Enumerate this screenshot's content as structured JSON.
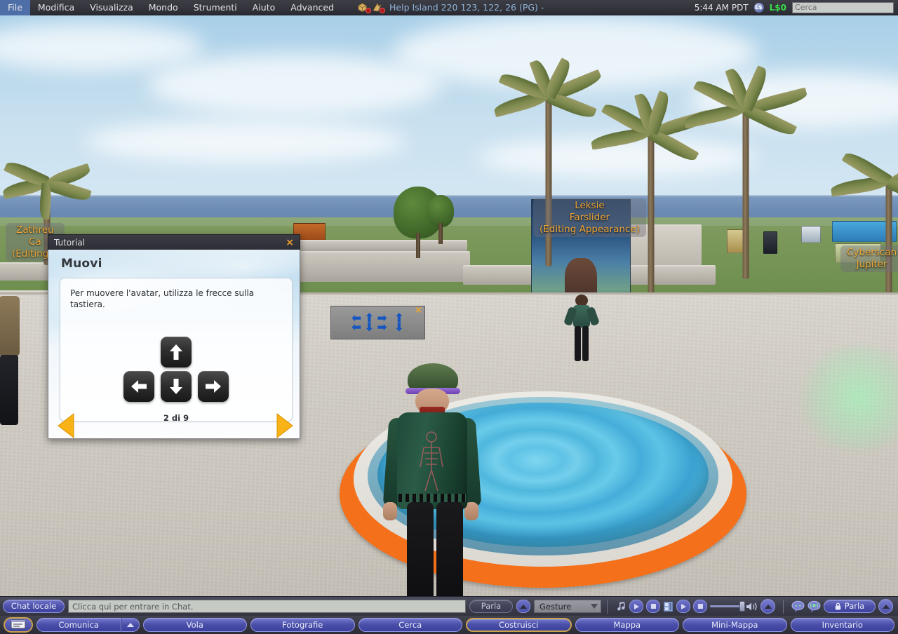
{
  "menubar": {
    "items": [
      "File",
      "Modifica",
      "Visualizza",
      "Mondo",
      "Strumenti",
      "Aiuto",
      "Advanced"
    ],
    "icons": [
      "build-disabled-icon",
      "fly-disabled-icon"
    ],
    "location": "Help Island 220 123, 122, 26 (PG) -",
    "clock": "5:44 AM PDT",
    "clock_badge": "L$",
    "balance": "L$0",
    "search_placeholder": "Cerca",
    "search_value": "",
    "search_icon": "magnifier-icon"
  },
  "world": {
    "nametags": [
      {
        "id": "zathreu",
        "lines": [
          "Zathreu",
          "Ca",
          "(Editing A"
        ]
      },
      {
        "id": "leksie",
        "lines": [
          "Leksie",
          "Farslider",
          "(Editing Appearance)"
        ]
      },
      {
        "id": "cyberscan",
        "lines": [
          "Cyberscan",
          "Jupiter"
        ]
      }
    ],
    "move_floater": {
      "name": "movement-controls-floater",
      "close_label": "×",
      "arrows": [
        "left-arrow",
        "up-arrow",
        "down-arrow",
        "right-arrow",
        "up-up-arrow",
        "down-down-arrow"
      ]
    }
  },
  "tutorial": {
    "window_title": "Tutorial",
    "close_label": "×",
    "heading": "Muovi",
    "body_text": "Per muovere l'avatar, utilizza le frecce sulla tastiera.",
    "page_label": "2 di 9",
    "keys": [
      "arrow-up-key",
      "arrow-left-key",
      "arrow-down-key",
      "arrow-right-key"
    ],
    "prev_label": "previous-page-arrow",
    "next_label": "next-page-arrow"
  },
  "chatbar": {
    "local_chat_label": "Chat locale",
    "chat_placeholder": "Clicca qui per entrare in Chat.",
    "chat_value": "",
    "talk_label": "Parla",
    "gesture_label": "Gesture",
    "media": {
      "music_icon": "music-note-icon",
      "music_play": "play-icon",
      "music_stop": "stop-icon",
      "video_icon": "film-icon",
      "video_play": "play-icon",
      "video_stop": "stop-icon",
      "volume_icon": "speaker-icon",
      "expand_icon": "chevron-up-icon"
    },
    "voice": {
      "chat_bubble_icon": "speech-bubble-icon",
      "voice_bubble_icon": "voice-bubble-icon",
      "talk_button_label": "Parla",
      "lock_icon": "lock-icon",
      "expand_icon": "chevron-up-icon"
    }
  },
  "toolbar": {
    "chat_toggle_icon": "chat-window-icon",
    "buttons": [
      {
        "label": "Comunica",
        "has_caret": true,
        "selected": false
      },
      {
        "label": "Vola",
        "has_caret": false,
        "selected": false
      },
      {
        "label": "Fotografie",
        "has_caret": false,
        "selected": false
      },
      {
        "label": "Cerca",
        "has_caret": false,
        "selected": false
      },
      {
        "label": "Costruisci",
        "has_caret": false,
        "selected": true
      },
      {
        "label": "Mappa",
        "has_caret": false,
        "selected": false
      },
      {
        "label": "Mini-Mappa",
        "has_caret": false,
        "selected": false
      },
      {
        "label": "Inventario",
        "has_caret": false,
        "selected": false
      }
    ]
  },
  "colors": {
    "accent_orange": "#f0a030",
    "pool_orange": "#f4701a",
    "nametag_text": "#f0a837",
    "balance_green": "#39dd4a",
    "button_blue": "#4a4fa8",
    "location_blue": "#8fb4d8"
  }
}
